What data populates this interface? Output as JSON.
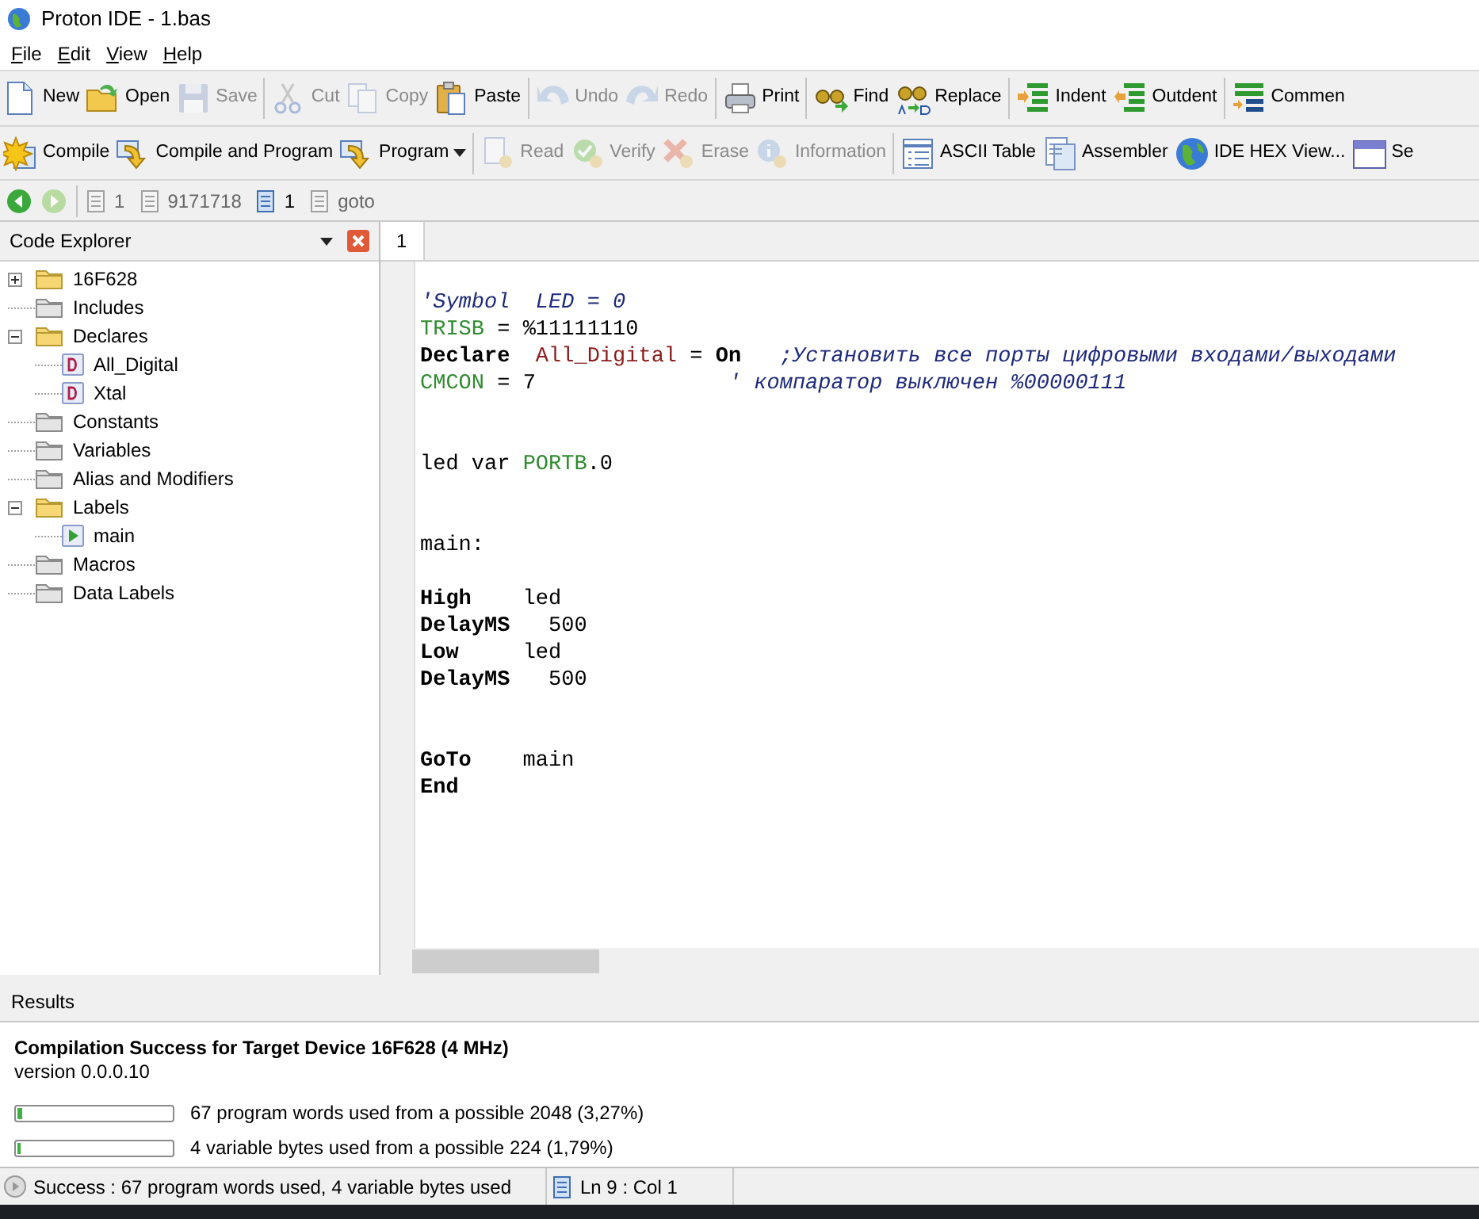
{
  "window": {
    "title": "Proton IDE - 1.bas"
  },
  "menu": [
    {
      "label": "File"
    },
    {
      "label": "Edit"
    },
    {
      "label": "View"
    },
    {
      "label": "Help"
    }
  ],
  "toolbar_rows": [
    [
      [
        {
          "kind": "new",
          "label": "New",
          "disabled": false
        },
        {
          "kind": "open",
          "label": "Open",
          "disabled": false
        },
        {
          "kind": "save",
          "label": "Save",
          "disabled": true
        }
      ],
      [
        {
          "kind": "cut",
          "label": "Cut",
          "disabled": true
        },
        {
          "kind": "copy",
          "label": "Copy",
          "disabled": true
        },
        {
          "kind": "paste",
          "label": "Paste",
          "disabled": false
        }
      ],
      [
        {
          "kind": "undo",
          "label": "Undo",
          "disabled": true
        },
        {
          "kind": "redo",
          "label": "Redo",
          "disabled": true
        }
      ],
      [
        {
          "kind": "print",
          "label": "Print",
          "disabled": false
        }
      ],
      [
        {
          "kind": "find",
          "label": "Find",
          "disabled": false
        },
        {
          "kind": "replace",
          "label": "Replace",
          "disabled": false
        }
      ],
      [
        {
          "kind": "indent",
          "label": "Indent",
          "disabled": false
        },
        {
          "kind": "outdent",
          "label": "Outdent",
          "disabled": false
        }
      ],
      [
        {
          "kind": "comment",
          "label": "Commen",
          "disabled": false
        }
      ]
    ],
    [
      [
        {
          "kind": "compile",
          "label": "Compile",
          "disabled": false
        },
        {
          "kind": "program",
          "label": "Compile and Program",
          "disabled": false
        },
        {
          "kind": "program-menu",
          "label": "Program",
          "disabled": false
        }
      ],
      [
        {
          "kind": "read",
          "label": "Read",
          "disabled": true
        },
        {
          "kind": "verify",
          "label": "Verify",
          "disabled": true
        },
        {
          "kind": "erase",
          "label": "Erase",
          "disabled": true
        },
        {
          "kind": "info",
          "label": "Information",
          "disabled": true
        }
      ],
      [
        {
          "kind": "table",
          "label": "ASCII Table",
          "disabled": false
        },
        {
          "kind": "assembler",
          "label": "Assembler",
          "disabled": false
        },
        {
          "kind": "globe",
          "label": "IDE HEX View...",
          "disabled": false
        },
        {
          "kind": "window",
          "label": "Se",
          "disabled": false
        }
      ]
    ]
  ],
  "nav": {
    "back": {
      "disabled": false
    },
    "forward": {
      "disabled": true
    },
    "items": [
      {
        "label": "1",
        "selected": false
      },
      {
        "label": "9171718",
        "selected": false
      },
      {
        "label": "1",
        "selected": true
      },
      {
        "label": "goto",
        "selected": false
      }
    ]
  },
  "code_explorer": {
    "title": "Code Explorer",
    "tree": [
      {
        "label": "16F628",
        "kind": "folder",
        "expanded": false
      },
      {
        "label": "Includes",
        "kind": "empty-folder"
      },
      {
        "label": "Declares",
        "kind": "folder",
        "expanded": true,
        "children": [
          {
            "label": "All_Digital",
            "kind": "declare"
          },
          {
            "label": "Xtal",
            "kind": "declare"
          }
        ]
      },
      {
        "label": "Constants",
        "kind": "empty-folder"
      },
      {
        "label": "Variables",
        "kind": "empty-folder"
      },
      {
        "label": "Alias and Modifiers",
        "kind": "empty-folder"
      },
      {
        "label": "Labels",
        "kind": "folder",
        "expanded": true,
        "children": [
          {
            "label": "main",
            "kind": "label"
          }
        ]
      },
      {
        "label": "Macros",
        "kind": "empty-folder"
      },
      {
        "label": "Data Labels",
        "kind": "empty-folder"
      }
    ]
  },
  "editor": {
    "tabs": [
      {
        "label": "1",
        "selected": true
      }
    ],
    "lines": [
      {
        "kind": "code",
        "segments": [
          {
            "kind": "comment",
            "text": "'Symbol  LED = 0"
          }
        ]
      },
      {
        "kind": "code",
        "segments": [
          {
            "kind": "register",
            "text": "TRISB"
          },
          {
            "kind": "plain",
            "text": " = %11111110"
          }
        ]
      },
      {
        "kind": "code",
        "segments": [
          {
            "kind": "keyword",
            "text": "Declare"
          },
          {
            "kind": "ident",
            "text": "  All_Digital"
          },
          {
            "kind": "plain",
            "text": " = "
          },
          {
            "kind": "keyword",
            "text": "On"
          },
          {
            "kind": "comment",
            "text": "   ;Установить все порты цифровыми входами/выходами"
          }
        ]
      },
      {
        "kind": "code",
        "segments": [
          {
            "kind": "register",
            "text": "CMCON"
          },
          {
            "kind": "plain",
            "text": " = 7               "
          },
          {
            "kind": "comment",
            "text": "' компаратор выключен %00000111"
          }
        ]
      },
      {
        "kind": "blank"
      },
      {
        "kind": "blank"
      },
      {
        "kind": "code",
        "segments": [
          {
            "kind": "plain",
            "text": "led var "
          },
          {
            "kind": "register",
            "text": "PORTB"
          },
          {
            "kind": "plain",
            "text": ".0"
          }
        ]
      },
      {
        "kind": "blank"
      },
      {
        "kind": "blank"
      },
      {
        "kind": "code",
        "segments": [
          {
            "kind": "plain",
            "text": "main:"
          }
        ]
      },
      {
        "kind": "blank"
      },
      {
        "kind": "code",
        "segments": [
          {
            "kind": "keyword",
            "text": "High"
          },
          {
            "kind": "plain",
            "text": "    led"
          }
        ]
      },
      {
        "kind": "code",
        "segments": [
          {
            "kind": "keyword",
            "text": "DelayMS"
          },
          {
            "kind": "plain",
            "text": "   500"
          }
        ]
      },
      {
        "kind": "code",
        "segments": [
          {
            "kind": "keyword",
            "text": "Low"
          },
          {
            "kind": "plain",
            "text": "     led"
          }
        ]
      },
      {
        "kind": "code",
        "segments": [
          {
            "kind": "keyword",
            "text": "DelayMS"
          },
          {
            "kind": "plain",
            "text": "   500"
          }
        ]
      },
      {
        "kind": "blank"
      },
      {
        "kind": "blank"
      },
      {
        "kind": "code",
        "segments": [
          {
            "kind": "keyword",
            "text": "GoTo"
          },
          {
            "kind": "plain",
            "text": "    main"
          }
        ]
      },
      {
        "kind": "code",
        "segments": [
          {
            "kind": "keyword",
            "text": "End"
          }
        ]
      }
    ]
  },
  "results": {
    "title": "Results",
    "heading": "Compilation Success for Target Device 16F628 (4 MHz)",
    "version": "version 0.0.0.10",
    "meters": [
      {
        "level": 0.0327,
        "text": "67 program words used from a possible 2048 (3,27%)"
      },
      {
        "level": 0.0179,
        "text": "4 variable bytes used from a possible 224 (1,79%)"
      }
    ]
  },
  "status_bar": {
    "message": "Success : 67 program words used, 4 variable bytes used",
    "position": "Ln 9 : Col 1"
  }
}
